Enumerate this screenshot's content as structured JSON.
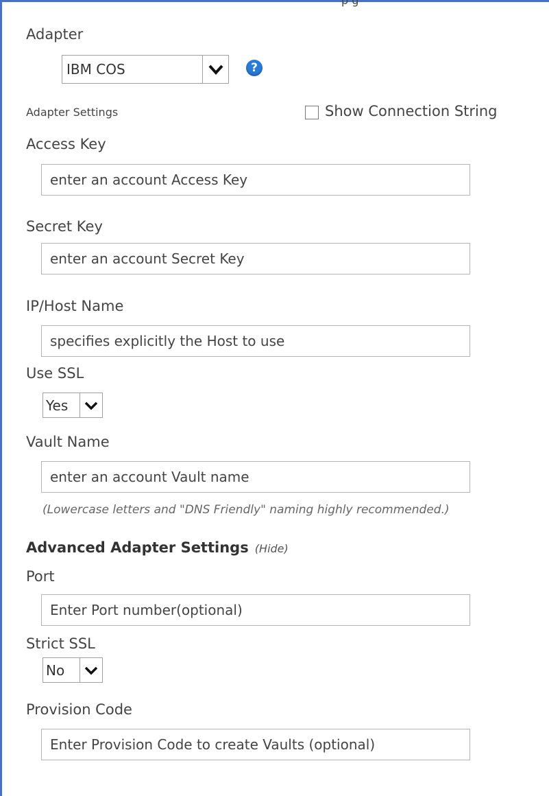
{
  "top_fragment": "p        g",
  "adapter": {
    "label": "Adapter",
    "selected": "IBM COS",
    "help_symbol": "?"
  },
  "adapter_settings": {
    "label": "Adapter Settings",
    "show_connection_string": "Show Connection String",
    "show_connection_string_checked": false
  },
  "access_key": {
    "label": "Access Key",
    "placeholder": "enter an account Access Key"
  },
  "secret_key": {
    "label": "Secret Key",
    "placeholder": "enter an account Secret Key"
  },
  "host_name": {
    "label": "IP/Host Name",
    "placeholder": "specifies explicitly the Host to use"
  },
  "use_ssl": {
    "label": "Use SSL",
    "selected": "Yes"
  },
  "vault_name": {
    "label": "Vault Name",
    "placeholder": "enter an account Vault name",
    "hint": "(Lowercase letters and \"DNS Friendly\" naming highly recommended.)"
  },
  "advanced": {
    "title": "Advanced Adapter Settings",
    "toggle": "(Hide)"
  },
  "port": {
    "label": "Port",
    "placeholder": "Enter Port number(optional)"
  },
  "strict_ssl": {
    "label": "Strict SSL",
    "selected": "No"
  },
  "provision_code": {
    "label": "Provision Code",
    "placeholder": "Enter Provision Code to create Vaults (optional)"
  },
  "icons": {
    "help": "help-icon",
    "dropdown": "chevron-down-icon"
  },
  "colors": {
    "frame": "#4472c4",
    "help_icon": "#2a7bd8"
  }
}
